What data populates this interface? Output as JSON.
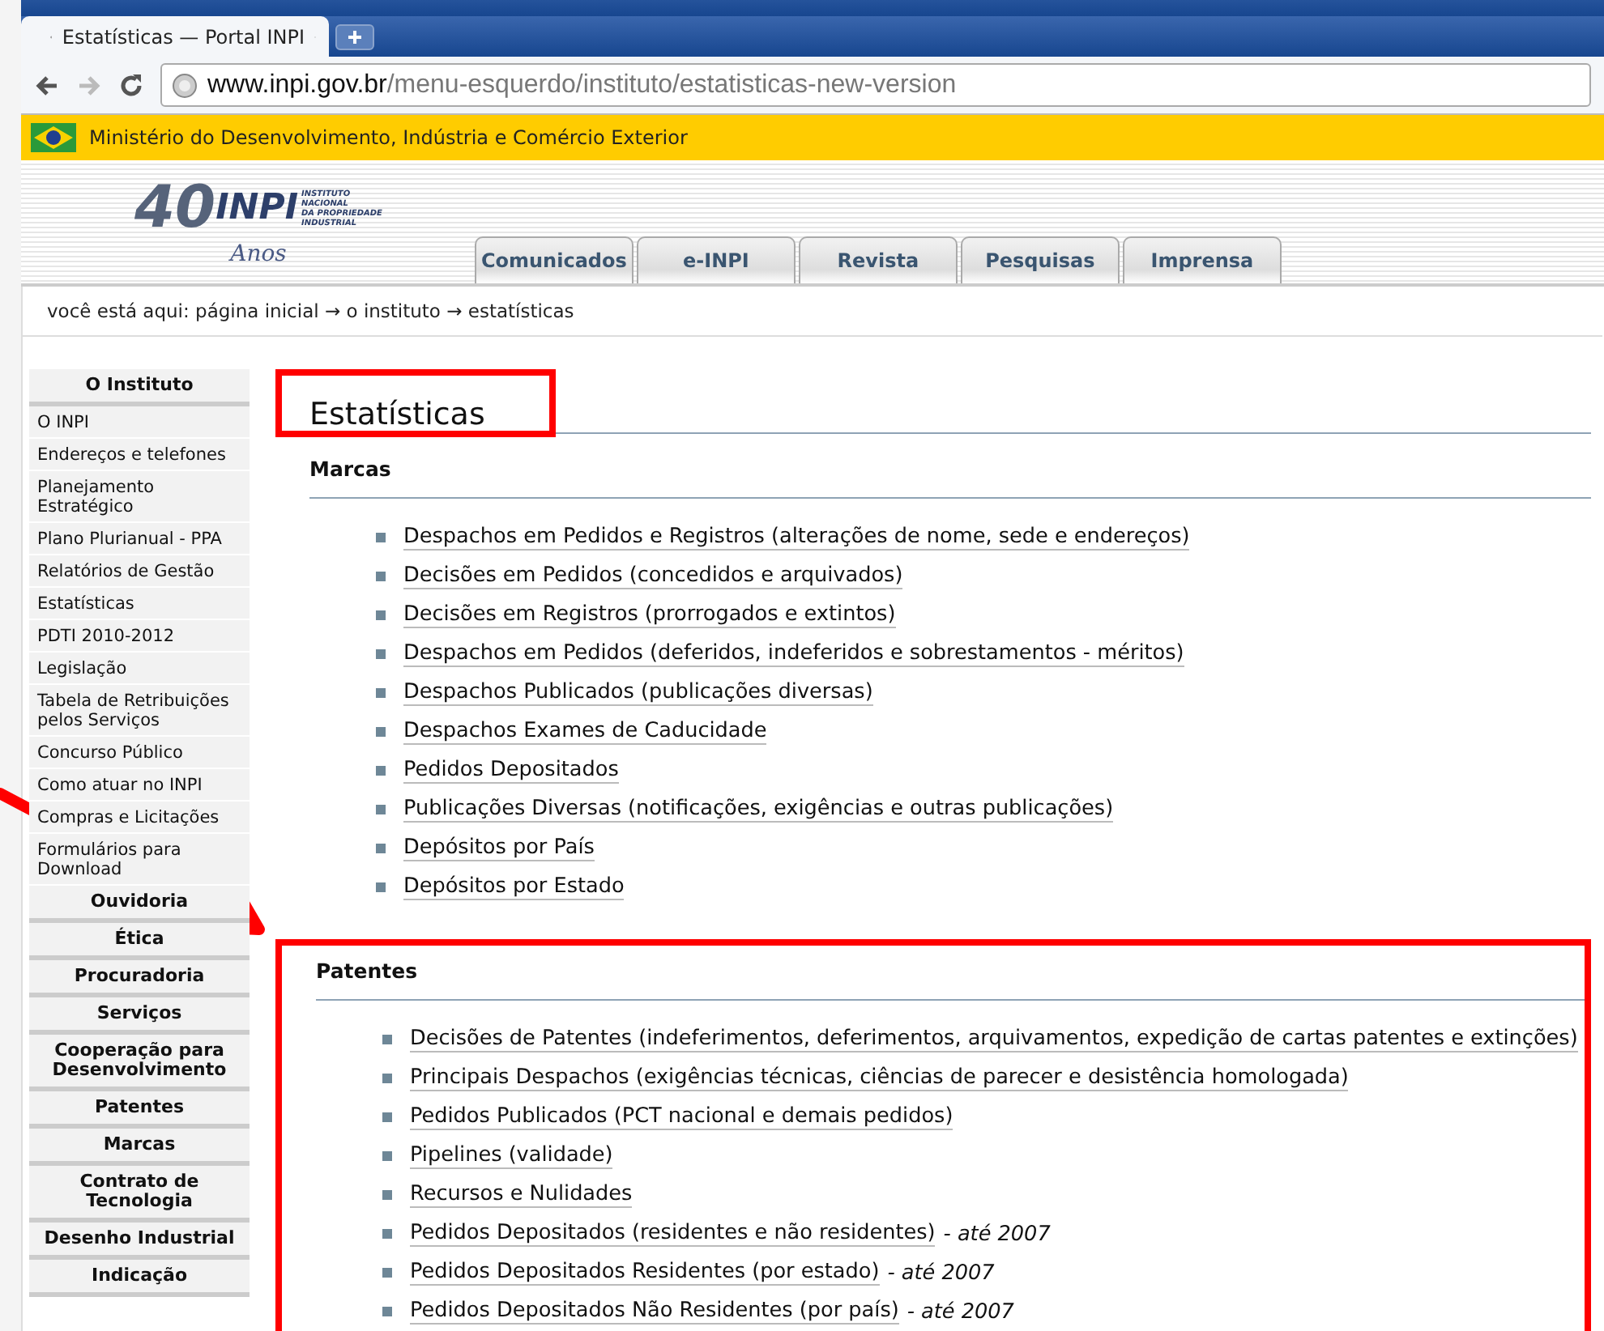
{
  "browser": {
    "tab_title": "Estatísticas — Portal INPI",
    "url_host": "www.inpi.gov.br",
    "url_path": "/menu-esquerdo/instituto/estatisticas-new-version"
  },
  "gov_bar": {
    "text": "Ministério do Desenvolvimento, Indústria e Comércio Exterior"
  },
  "logo": {
    "number": "40",
    "name": "INPI",
    "lines": [
      "INSTITUTO",
      "NACIONAL",
      "DA PROPRIEDADE",
      "INDUSTRIAL"
    ],
    "script": "Anos"
  },
  "top_tabs": [
    {
      "label": "Comunicados"
    },
    {
      "label": "e-INPI"
    },
    {
      "label": "Revista"
    },
    {
      "label": "Pesquisas"
    },
    {
      "label": "Imprensa"
    }
  ],
  "breadcrumb": "você está aqui: página inicial → o instituto → estatísticas",
  "sidebar": [
    {
      "kind": "header",
      "label": "O Instituto"
    },
    {
      "kind": "link",
      "label": "O INPI"
    },
    {
      "kind": "link",
      "label": "Endereços e telefones"
    },
    {
      "kind": "link",
      "label": "Planejamento Estratégico"
    },
    {
      "kind": "link",
      "label": "Plano Plurianual - PPA"
    },
    {
      "kind": "link",
      "label": "Relatórios de Gestão"
    },
    {
      "kind": "link",
      "label": "Estatísticas"
    },
    {
      "kind": "link",
      "label": "PDTI 2010-2012"
    },
    {
      "kind": "link",
      "label": "Legislação"
    },
    {
      "kind": "link",
      "label": "Tabela de Retribuições pelos Serviços"
    },
    {
      "kind": "link",
      "label": "Concurso Público"
    },
    {
      "kind": "link",
      "label": "Como atuar no INPI"
    },
    {
      "kind": "link",
      "label": "Compras e Licitações"
    },
    {
      "kind": "link",
      "label": "Formulários para Download"
    },
    {
      "kind": "header",
      "label": "Ouvidoria"
    },
    {
      "kind": "header",
      "label": "Ética"
    },
    {
      "kind": "header",
      "label": "Procuradoria"
    },
    {
      "kind": "header",
      "label": "Serviços"
    },
    {
      "kind": "header",
      "label": "Cooperação para Desenvolvimento"
    },
    {
      "kind": "header",
      "label": "Patentes"
    },
    {
      "kind": "header",
      "label": "Marcas"
    },
    {
      "kind": "header",
      "label": "Contrato de Tecnologia"
    },
    {
      "kind": "header",
      "label": "Desenho Industrial"
    },
    {
      "kind": "header",
      "label": "Indicação"
    }
  ],
  "page_title": "Estatísticas",
  "sections": [
    {
      "title": "Marcas",
      "highlighted": false,
      "links": [
        {
          "text": "Despachos em Pedidos e Registros (alterações de nome, sede e endereços)"
        },
        {
          "text": "Decisões em Pedidos (concedidos e arquivados)"
        },
        {
          "text": "Decisões em Registros (prorrogados e extintos)"
        },
        {
          "text": "Despachos em Pedidos (deferidos, indeferidos e sobrestamentos - méritos)"
        },
        {
          "text": "Despachos Publicados (publicações diversas)"
        },
        {
          "text": "Despachos Exames de Caducidade"
        },
        {
          "text": "Pedidos Depositados"
        },
        {
          "text": "Publicações Diversas (notificações, exigências e outras publicações)"
        },
        {
          "text": "Depósitos por País"
        },
        {
          "text": "Depósitos por Estado"
        }
      ]
    },
    {
      "title": "Patentes",
      "highlighted": true,
      "links": [
        {
          "text": "Decisões de Patentes (indeferimentos, deferimentos, arquivamentos, expedição de cartas patentes e extinções)"
        },
        {
          "text": "Principais Despachos (exigências técnicas, ciências de parecer e desistência homologada)"
        },
        {
          "text": "Pedidos Publicados (PCT nacional e demais pedidos)"
        },
        {
          "text": "Pipelines (validade)"
        },
        {
          "text": "Recursos e Nulidades"
        },
        {
          "text": "Pedidos Depositados (residentes e não residentes)",
          "note": "- até 2007"
        },
        {
          "text": "Pedidos Depositados Residentes (por estado)",
          "note": "- até 2007"
        },
        {
          "text": "Pedidos Depositados Não Residentes (por país)",
          "note": "- até 2007"
        }
      ]
    }
  ]
}
